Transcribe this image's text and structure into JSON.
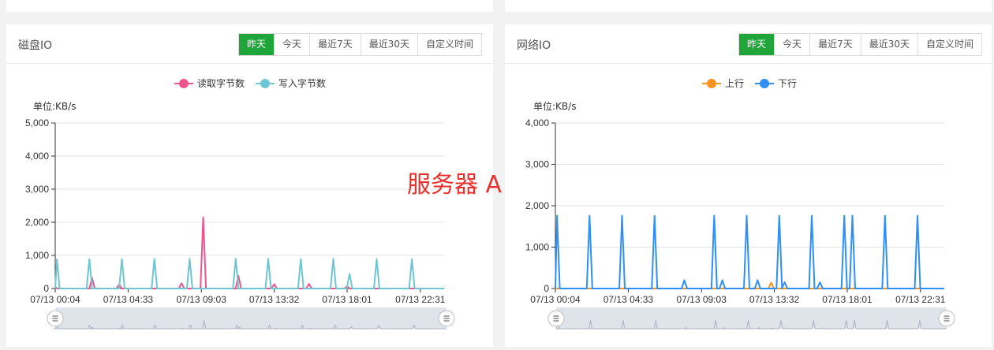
{
  "range_buttons": [
    "昨天",
    "今天",
    "最近7天",
    "最近30天",
    "自定义时间"
  ],
  "active_range": "昨天",
  "overlay_label": "服务器 A",
  "disk": {
    "title": "磁盘IO",
    "unit_label": "单位:KB/s",
    "legend": [
      {
        "label": "读取字节数",
        "color": "#f0548d"
      },
      {
        "label": "写入字节数",
        "color": "#6dc6d2"
      }
    ]
  },
  "network": {
    "title": "网络IO",
    "unit_label": "单位:KB/s",
    "legend": [
      {
        "label": "上行",
        "color": "#f7931e"
      },
      {
        "label": "下行",
        "color": "#2e8ff7"
      }
    ]
  },
  "chart_data": [
    {
      "type": "line",
      "title": "磁盘IO",
      "ylabel": "单位:KB/s",
      "ylim": [
        0,
        5000
      ],
      "yticks": [
        0,
        1000,
        2000,
        3000,
        4000,
        5000
      ],
      "ytick_labels": [
        "0",
        "1,000",
        "2,000",
        "3,000",
        "4,000",
        "5,000"
      ],
      "x_tick_labels": [
        "07/13 00:04",
        "07/13 04:33",
        "07/13 09:03",
        "07/13 13:32",
        "07/13 18:01",
        "07/13 22:31"
      ],
      "x_range": [
        "07/13 00:04",
        "07/13 23:59"
      ],
      "grid": true,
      "legend_position": "top",
      "series": [
        {
          "name": "读取字节数",
          "color": "#f0548d",
          "spikes": [
            [
              "07/13 00:04",
              30
            ],
            [
              "07/13 02:20",
              320
            ],
            [
              "07/13 04:00",
              120
            ],
            [
              "07/13 07:50",
              160
            ],
            [
              "07/13 09:10",
              2150
            ],
            [
              "07/13 11:20",
              380
            ],
            [
              "07/13 13:32",
              130
            ],
            [
              "07/13 15:40",
              140
            ],
            [
              "07/13 18:01",
              60
            ]
          ]
        },
        {
          "name": "写入字节数",
          "color": "#6dc6d2",
          "spikes": [
            [
              "07/13 00:10",
              880
            ],
            [
              "07/13 02:10",
              890
            ],
            [
              "07/13 04:10",
              890
            ],
            [
              "07/13 06:10",
              900
            ],
            [
              "07/13 08:20",
              900
            ],
            [
              "07/13 11:10",
              900
            ],
            [
              "07/13 13:10",
              900
            ],
            [
              "07/13 15:10",
              890
            ],
            [
              "07/13 17:10",
              900
            ],
            [
              "07/13 18:10",
              440
            ],
            [
              "07/13 19:50",
              890
            ],
            [
              "07/13 22:00",
              890
            ]
          ]
        }
      ]
    },
    {
      "type": "line",
      "title": "网络IO",
      "ylabel": "单位:KB/s",
      "ylim": [
        0,
        4000
      ],
      "yticks": [
        0,
        1000,
        2000,
        3000,
        4000
      ],
      "ytick_labels": [
        "0",
        "1,000",
        "2,000",
        "3,000",
        "4,000"
      ],
      "x_tick_labels": [
        "07/13 00:04",
        "07/13 04:33",
        "07/13 09:03",
        "07/13 13:32",
        "07/13 18:01",
        "07/13 22:31"
      ],
      "x_range": [
        "07/13 00:04",
        "07/13 23:59"
      ],
      "grid": true,
      "legend_position": "top",
      "series": [
        {
          "name": "上行",
          "color": "#f7931e",
          "spikes": [
            [
              "07/13 13:20",
              140
            ]
          ]
        },
        {
          "name": "下行",
          "color": "#2e8ff7",
          "spikes": [
            [
              "07/13 00:10",
              1760
            ],
            [
              "07/13 02:10",
              1760
            ],
            [
              "07/13 04:10",
              1760
            ],
            [
              "07/13 06:10",
              1760
            ],
            [
              "07/13 08:00",
              200
            ],
            [
              "07/13 09:50",
              1760
            ],
            [
              "07/13 10:20",
              200
            ],
            [
              "07/13 11:50",
              1760
            ],
            [
              "07/13 12:30",
              200
            ],
            [
              "07/13 13:50",
              1760
            ],
            [
              "07/13 14:10",
              150
            ],
            [
              "07/13 15:50",
              1760
            ],
            [
              "07/13 16:20",
              150
            ],
            [
              "07/13 17:50",
              1760
            ],
            [
              "07/13 18:20",
              1760
            ],
            [
              "07/13 20:20",
              1760
            ],
            [
              "07/13 22:20",
              1760
            ]
          ]
        }
      ]
    }
  ]
}
